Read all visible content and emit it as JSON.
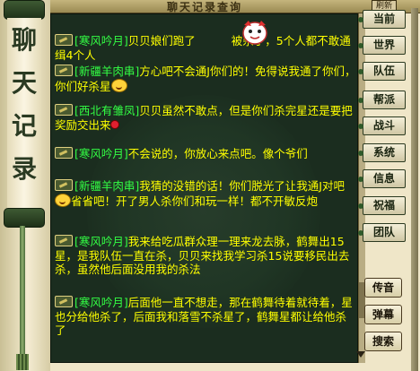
{
  "window": {
    "title": "聊天记录查询",
    "refresh_label": "刷新",
    "scroll_title": [
      "聊",
      "天",
      "记",
      "录"
    ]
  },
  "nav": [
    {
      "label": "当前"
    },
    {
      "label": "世界"
    },
    {
      "label": "队伍"
    },
    {
      "label": "帮派"
    },
    {
      "label": "战斗"
    },
    {
      "label": "系统"
    },
    {
      "label": "信息"
    },
    {
      "label": "祝福"
    },
    {
      "label": "团队"
    }
  ],
  "actions": {
    "rumor": "传音",
    "barrage": "弹幕",
    "search": "搜索"
  },
  "messages": [
    {
      "name": "[寒风吟月]",
      "pre": "贝贝娘们跑了",
      "post": "被杀了，5个人都不敢通缉4个人"
    },
    {
      "name": "[新疆羊肉串]",
      "pre": "方心吧不会通J你们的！免得说我通了你们，你们好杀星",
      "post": ""
    },
    {
      "name": "[西北有雏凤]",
      "pre": "贝贝虽然不敢点，但是你们杀完星还是要把奖励交出来",
      "post": ""
    },
    {
      "name": "[寒风吟月]",
      "pre": "不会说的，你放心来点吧。像个爷们",
      "post": ""
    },
    {
      "name": "[新疆羊肉串]",
      "pre": "我猜的没错的话！你们脱光了让我通J对吧",
      "post": "省省吧！开了男人杀你们和玩一样！都不开敏反炮"
    },
    {
      "name": "[寒风吟月]",
      "pre": "我来给吃瓜群众理一理来龙去脉，鹤舞出15星，是我队伍一直在杀，贝贝来找我学习杀15说要移民出去杀，虽然他后面没用我的杀法",
      "post": ""
    },
    {
      "name": "[寒风吟月]",
      "pre": "后面他一直不想走，那在鹤舞待着就待着，星也分给他杀了，后面我和落雪不杀星了，鹤舞星都让给他杀了",
      "post": ""
    }
  ]
}
